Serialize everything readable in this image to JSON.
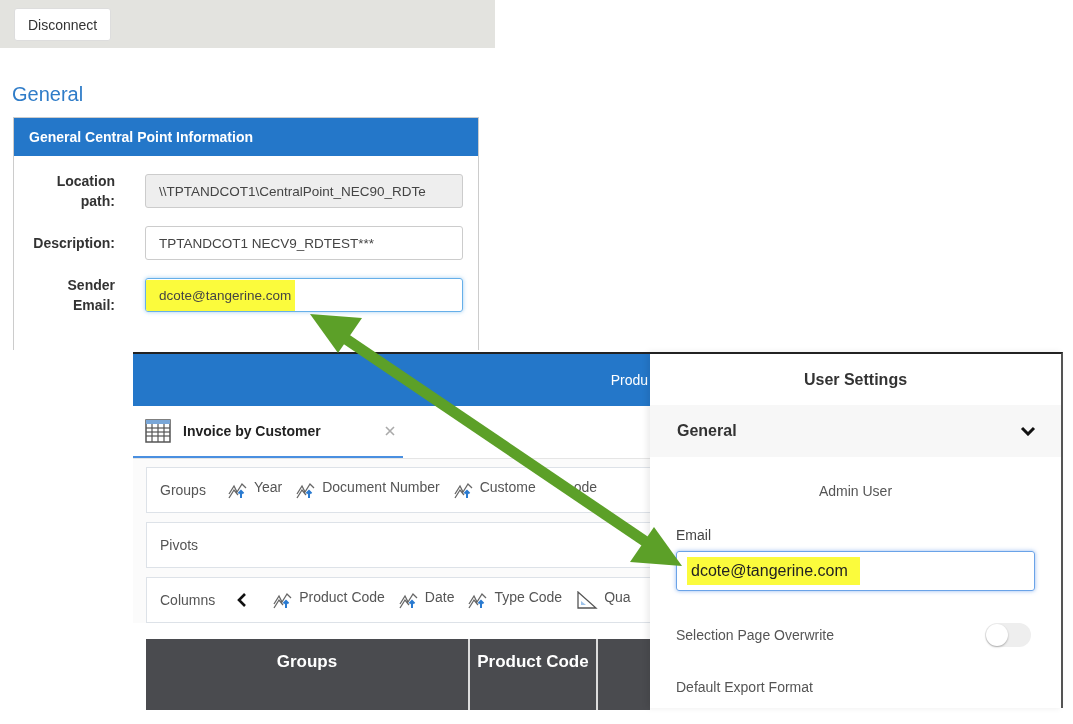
{
  "connection_panel": {
    "disconnect_button": "Disconnect",
    "section_title": "General",
    "card_title": "General Central Point Information",
    "fields": [
      {
        "label": "Location path:",
        "value": "\\\\TPTANDCOT1\\CentralPoint_NEC90_RDTe",
        "disabled": true,
        "highlighted": false,
        "focused": false
      },
      {
        "label": "Description:",
        "value": "TPTANDCOT1 NECV9_RDTEST***",
        "disabled": false,
        "highlighted": false,
        "focused": false
      },
      {
        "label": "Sender Email:",
        "value": "dcote@tangerine.com",
        "disabled": false,
        "highlighted": true,
        "focused": true
      }
    ]
  },
  "report_app": {
    "header_title": "Produ",
    "tab": {
      "label": "Invoice by Customer",
      "selected": true
    },
    "shelves": [
      {
        "label": "Groups",
        "has_scroll": false,
        "items": [
          {
            "label": "Year",
            "kind": "dimension"
          },
          {
            "label": "Document Number",
            "kind": "dimension"
          },
          {
            "label": "Custome",
            "label_tail": "ode",
            "kind": "dimension"
          }
        ]
      },
      {
        "label": "Pivots",
        "has_scroll": false
      },
      {
        "label": "Columns",
        "has_scroll": true,
        "items": [
          {
            "label": "Product Code",
            "kind": "dimension"
          },
          {
            "label": "Date",
            "kind": "dimension"
          },
          {
            "label": "Type Code",
            "kind": "dimension"
          },
          {
            "label": "Qua",
            "kind": "measure"
          }
        ]
      }
    ],
    "table": {
      "columns": [
        "Groups",
        "Product Code"
      ]
    }
  },
  "user_settings": {
    "title": "User Settings",
    "section": {
      "label": "General",
      "expanded": true
    },
    "user_name": "Admin User",
    "email": {
      "label": "Email",
      "value": "dcote@tangerine.com",
      "highlighted": true,
      "focused": true
    },
    "toggles": [
      {
        "label": "Selection Page Overwrite",
        "on": false
      }
    ],
    "next_label": "Default Export Format"
  }
}
